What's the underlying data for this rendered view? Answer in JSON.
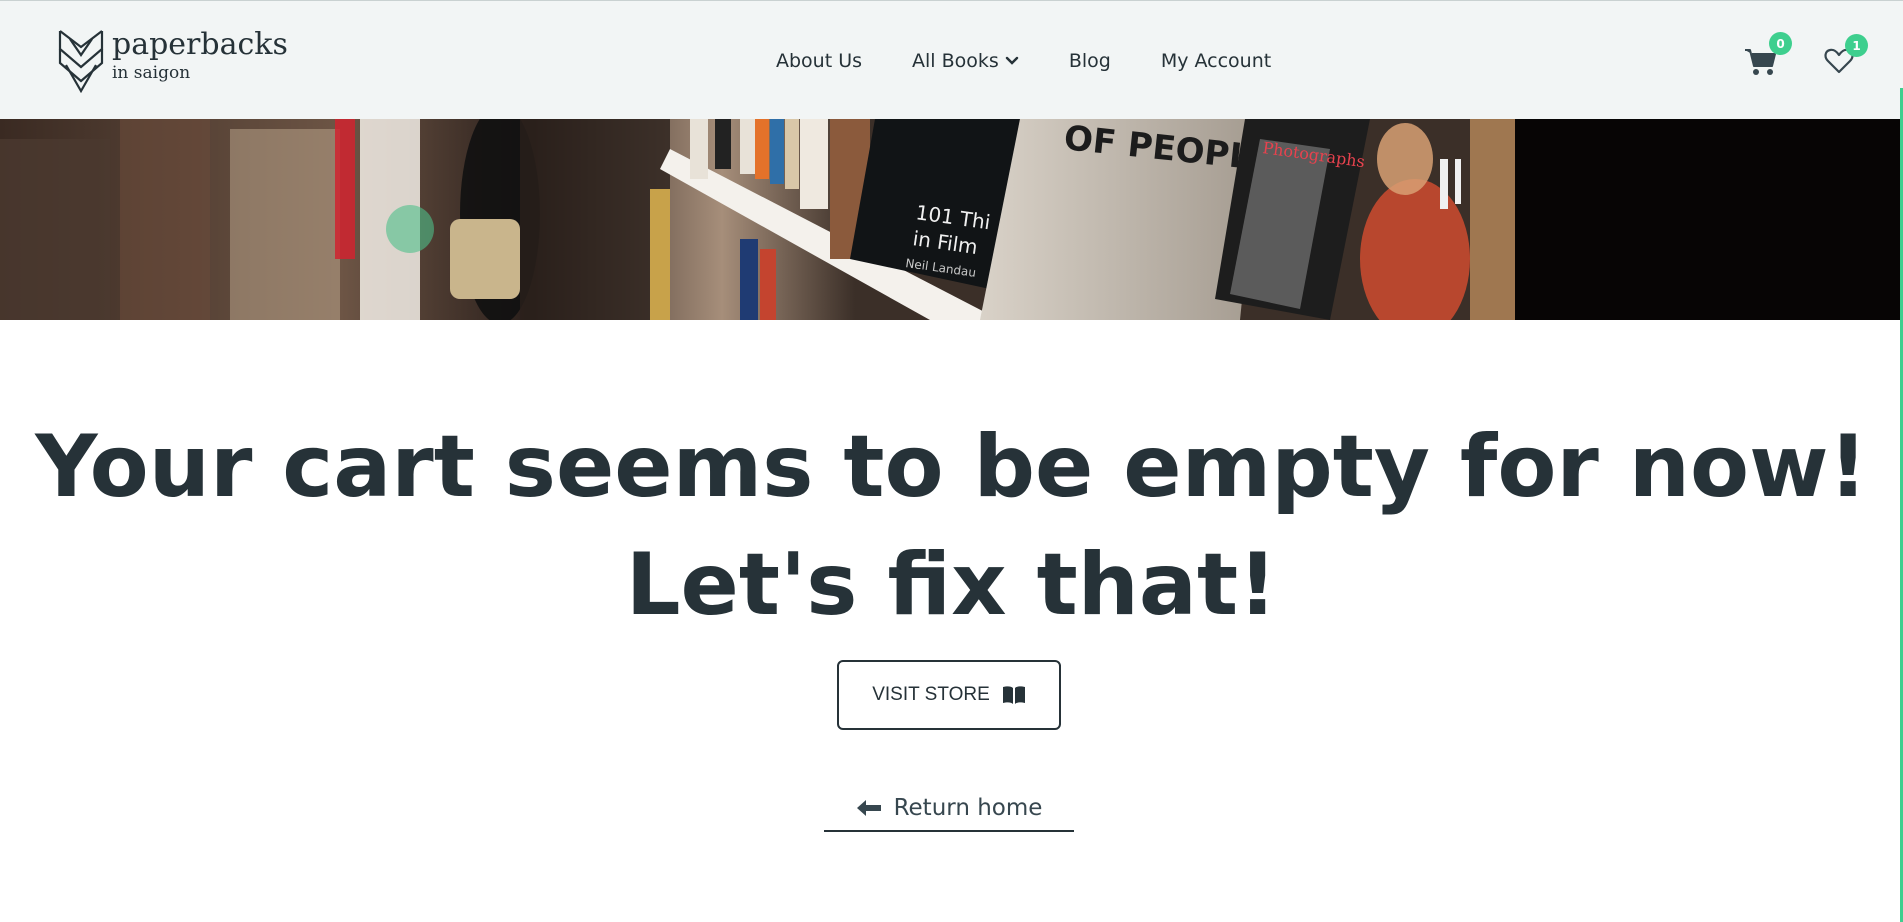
{
  "brand": {
    "name": "paperbacks",
    "tagline": "in saigon"
  },
  "nav": {
    "items": [
      {
        "label": "About Us"
      },
      {
        "label": "All Books"
      },
      {
        "label": "Blog"
      },
      {
        "label": "My Account"
      }
    ]
  },
  "header_icons": {
    "cart": {
      "icon": "cart-icon",
      "count": "0"
    },
    "wishlist": {
      "icon": "heart-icon",
      "count": "1"
    }
  },
  "banner": {
    "book_text_1": "101 Thi",
    "book_text_2": "in Film",
    "book_text_3": "Neil Landau",
    "book_text_4": "OF PEOPL",
    "book_text_5": "Photographs"
  },
  "main": {
    "headline_line1": "Your cart seems to be empty for now!",
    "headline_line2": "Let's fix that!",
    "visit_store_label": "VISIT STORE",
    "return_home_label": "Return home"
  },
  "colors": {
    "accent": "#3ecf8e",
    "text": "#263238",
    "header_bg": "#f2f5f5"
  }
}
